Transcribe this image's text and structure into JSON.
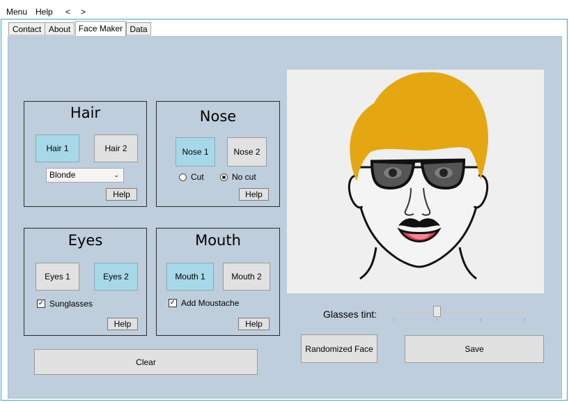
{
  "menu": {
    "items": [
      "Menu",
      "Help",
      "<",
      ">"
    ]
  },
  "tabs": [
    "Contact",
    "About",
    "Face Maker",
    "Data"
  ],
  "active_tab": "Face Maker",
  "hair": {
    "title": "Hair",
    "option1": "Hair 1",
    "option2": "Hair 2",
    "selected": "Hair 1",
    "color_value": "Blonde",
    "help": "Help",
    "color": "#e5a711"
  },
  "nose": {
    "title": "Nose",
    "option1": "Nose 1",
    "option2": "Nose 2",
    "selected": "Nose 1",
    "radio_cut": "Cut",
    "radio_nocut": "No cut",
    "radio_selected": "No cut",
    "help": "Help"
  },
  "eyes": {
    "title": "Eyes",
    "option1": "Eyes 1",
    "option2": "Eyes 2",
    "selected": "Eyes 2",
    "checkbox_label": "Sunglasses",
    "checked": true,
    "help": "Help"
  },
  "mouth": {
    "title": "Mouth",
    "option1": "Mouth 1",
    "option2": "Mouth 2",
    "selected": "Mouth 1",
    "checkbox_label": "Add Moustache",
    "checked": true,
    "help": "Help"
  },
  "clear_button": "Clear",
  "glasses_tint": {
    "label": "Glasses tint:",
    "value_fraction": 0.33
  },
  "randomize_button": "Randomized Face",
  "save_button": "Save",
  "colors": {
    "panel_bg": "#bfcedc",
    "selected_button": "#a7d8e8",
    "button": "#e1e1e1",
    "tab_border": "#3c9fd8"
  }
}
